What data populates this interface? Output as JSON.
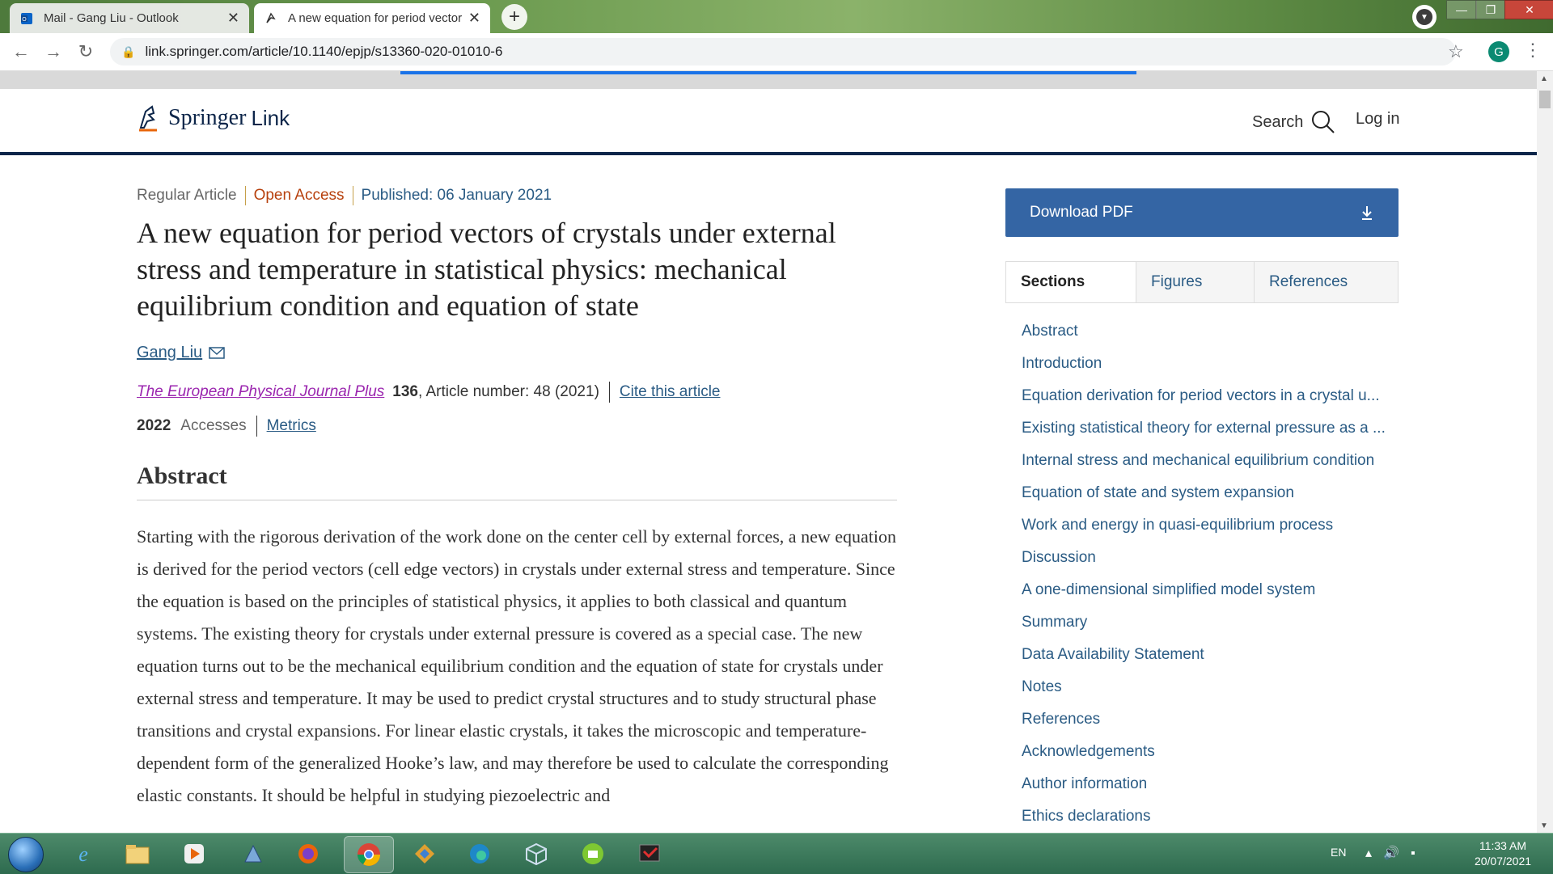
{
  "browser": {
    "tabs": [
      {
        "title": "Mail - Gang Liu - Outlook",
        "active": false,
        "icon": "outlook-icon"
      },
      {
        "title": "A new equation for period vectors",
        "active": true,
        "icon": "springer-icon"
      }
    ],
    "url": "link.springer.com/article/10.1140/epjp/s13360-020-01010-6",
    "profile_initial": "G"
  },
  "site": {
    "logo_word1": "Springer",
    "logo_word2": "Link",
    "search_label": "Search",
    "login_label": "Log in"
  },
  "article": {
    "type": "Regular Article",
    "open_access": "Open Access",
    "published": "Published: 06 January 2021",
    "title": "A new equation for period vectors of crystals under external stress and temperature in statistical physics: mechanical equilibrium condition and equation of state",
    "author": "Gang Liu",
    "journal": "The European Physical Journal Plus",
    "volume": "136",
    "article_number": ", Article number: 48 (2021)",
    "cite_label": "Cite this article",
    "accesses_count": "2022",
    "accesses_label": "Accesses",
    "metrics_label": "Metrics",
    "abstract_heading": "Abstract",
    "abstract_text": "Starting with the rigorous derivation of the work done on the center cell by external forces, a new equation is derived for the period vectors (cell edge vectors) in crystals under external stress and temperature. Since the equation is based on the principles of statistical physics, it applies to both classical and quantum systems. The existing theory for crystals under external pressure is covered as a special case. The new equation turns out to be the mechanical equilibrium condition and the equation of state for crystals under external stress and temperature. It may be used to predict crystal structures and to study structural phase transitions and crystal expansions. For linear elastic crystals, it takes the microscopic and temperature-dependent form of the generalized Hooke’s law, and may therefore be used to calculate the corresponding elastic constants. It should be helpful in studying piezoelectric and"
  },
  "sidebar": {
    "download_label": "Download PDF",
    "tabs": [
      "Sections",
      "Figures",
      "References"
    ],
    "sections": [
      "Abstract",
      "Introduction",
      "Equation derivation for period vectors in a crystal u...",
      "Existing statistical theory for external pressure as a ...",
      "Internal stress and mechanical equilibrium condition",
      "Equation of state and system expansion",
      "Work and energy in quasi-equilibrium process",
      "Discussion",
      "A one-dimensional simplified model system",
      "Summary",
      "Data Availability Statement",
      "Notes",
      "References",
      "Acknowledgements",
      "Author information",
      "Ethics declarations"
    ]
  },
  "taskbar": {
    "language": "EN",
    "time": "11:33 AM",
    "date": "20/07/2021"
  },
  "colors": {
    "springer_navy": "#0c2549",
    "link_blue": "#2a5b84",
    "open_access_orange": "#b7410e",
    "download_blue": "#3465a4",
    "journal_purple": "#9b26af"
  }
}
